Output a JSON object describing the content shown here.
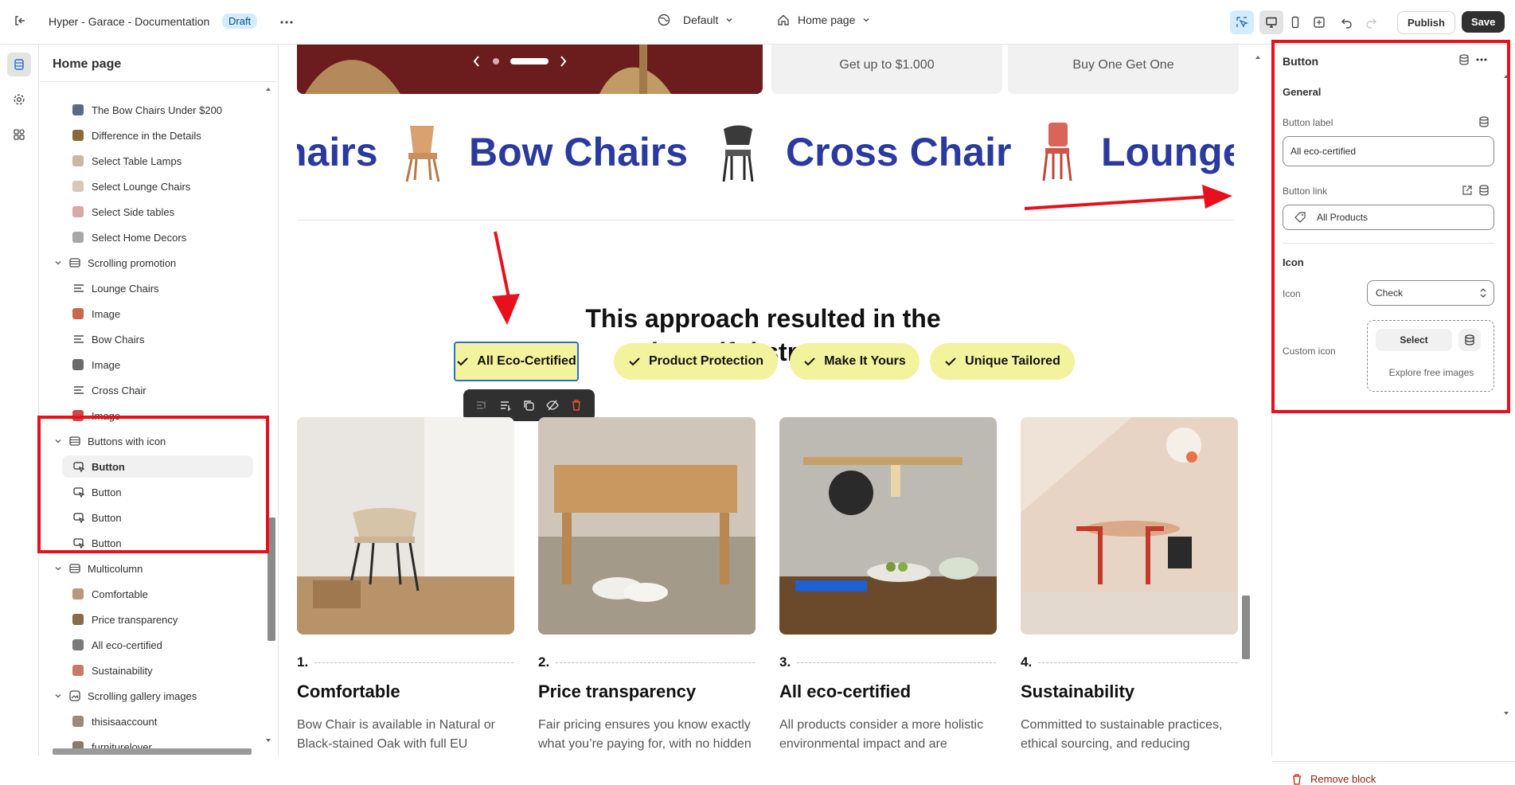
{
  "topbar": {
    "exit_icon": "exit-icon",
    "store_title": "Hyper - Garace - Documentation",
    "status_badge": "Draft",
    "theme_selector": "Default",
    "page_selector": "Home page",
    "publish_label": "Publish",
    "save_label": "Save"
  },
  "sidebar": {
    "title": "Home page",
    "items": [
      {
        "label": "The Bow Chairs Under $200",
        "level": 2,
        "kind": "image",
        "color": "#5a6a8a"
      },
      {
        "label": "Difference in the Details",
        "level": 2,
        "kind": "image",
        "color": "#8a6a3a"
      },
      {
        "label": "Select Table Lamps",
        "level": 2,
        "kind": "image",
        "color": "#c8b8a8"
      },
      {
        "label": "Select Lounge Chairs",
        "level": 2,
        "kind": "image",
        "color": "#d8c8b8"
      },
      {
        "label": "Select Side tables",
        "level": 2,
        "kind": "image",
        "color": "#d8a8a8"
      },
      {
        "label": "Select Home Decors",
        "level": 2,
        "kind": "image",
        "color": "#a8a8a8"
      },
      {
        "label": "Scrolling promotion",
        "level": 1,
        "kind": "section"
      },
      {
        "label": "Lounge Chairs",
        "level": 2,
        "kind": "text"
      },
      {
        "label": "Image",
        "level": 2,
        "kind": "image",
        "color": "#c86a4a"
      },
      {
        "label": "Bow Chairs",
        "level": 2,
        "kind": "text"
      },
      {
        "label": "Image",
        "level": 2,
        "kind": "image",
        "color": "#6a6a6a"
      },
      {
        "label": "Cross Chair",
        "level": 2,
        "kind": "text"
      },
      {
        "label": "Image",
        "level": 2,
        "kind": "image",
        "color": "#c84a4a"
      },
      {
        "label": "Buttons with icon",
        "level": 1,
        "kind": "section"
      },
      {
        "label": "Button",
        "level": 2,
        "kind": "button",
        "selected": true
      },
      {
        "label": "Button",
        "level": 2,
        "kind": "button"
      },
      {
        "label": "Button",
        "level": 2,
        "kind": "button"
      },
      {
        "label": "Button",
        "level": 2,
        "kind": "button"
      },
      {
        "label": "Multicolumn",
        "level": 1,
        "kind": "section"
      },
      {
        "label": "Comfortable",
        "level": 2,
        "kind": "image",
        "color": "#b89878"
      },
      {
        "label": "Price transparency",
        "level": 2,
        "kind": "image",
        "color": "#8a6a4a"
      },
      {
        "label": "All eco-certified",
        "level": 2,
        "kind": "image",
        "color": "#7a7a7a"
      },
      {
        "label": "Sustainability",
        "level": 2,
        "kind": "image",
        "color": "#c87a6a"
      },
      {
        "label": "Scrolling gallery images",
        "level": 1,
        "kind": "gallery"
      },
      {
        "label": "thisisaaccount",
        "level": 2,
        "kind": "image",
        "color": "#9a8a7a"
      },
      {
        "label": "furniturelover",
        "level": 2,
        "kind": "image",
        "color": "#8a7a6a"
      }
    ]
  },
  "canvas": {
    "promo_cards": [
      "Get up to $1.000",
      "Buy One Get One"
    ],
    "marquee": [
      "hairs",
      "Bow Chairs",
      "Cross Chair",
      "Lounge"
    ],
    "heading_line1": "This approach resulted in the",
    "heading_line2": "beautiful structure",
    "buttons": [
      "All Eco-Certified",
      "Product Protection",
      "Make It Yours",
      "Unique Tailored"
    ],
    "cards": [
      {
        "num": "1.",
        "title": "Comfortable",
        "desc": "Bow Chair is available in Natural or Black-stained Oak with full EU Ecolabel"
      },
      {
        "num": "2.",
        "title": "Price transparency",
        "desc": "Fair pricing ensures you know exactly what you’re paying for, with no hidden"
      },
      {
        "num": "3.",
        "title": "All eco-certified",
        "desc": "All products consider a more holistic environmental impact and are"
      },
      {
        "num": "4.",
        "title": "Sustainability",
        "desc": "Committed to sustainable practices, ethical sourcing, and reducing"
      }
    ]
  },
  "panel": {
    "title": "Button",
    "general_heading": "General",
    "button_label_label": "Button label",
    "button_label_value": "All eco-certified",
    "button_link_label": "Button link",
    "button_link_value": "All Products",
    "icon_heading": "Icon",
    "icon_label": "Icon",
    "icon_value": "Check",
    "custom_icon_label": "Custom icon",
    "select_label": "Select",
    "explore_label": "Explore free images",
    "remove_label": "Remove block"
  },
  "colors": {
    "accent_blue": "#2b3a9e",
    "pill_yellow": "#f3f29d",
    "highlight_red": "#e8101c",
    "selection_blue": "#2c6ecb"
  }
}
